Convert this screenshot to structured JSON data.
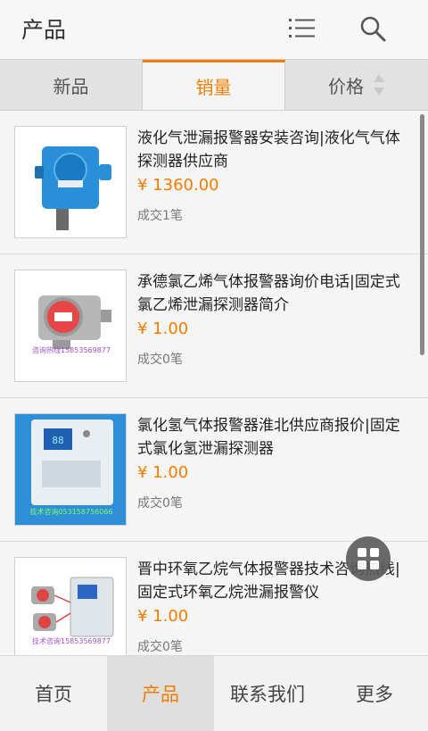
{
  "header": {
    "title": "产品",
    "menu_icon": "list-menu-icon",
    "search_icon": "search-icon"
  },
  "tabs": [
    {
      "label": "新品",
      "active": false
    },
    {
      "label": "销量",
      "active": true
    },
    {
      "label": "价格",
      "active": false,
      "icon": "sort-arrows-icon"
    }
  ],
  "products": [
    {
      "name": "液化气泄漏报警器安装咨询|液化气气体探测器供应商",
      "price": "¥ 1360.00",
      "sold": "成交1笔",
      "image_text": ""
    },
    {
      "name": "承德氯乙烯气体报警器询价电话|固定式氯乙烯泄漏探测器简介",
      "price": "¥ 1.00",
      "sold": "成交0笔",
      "image_text": "咨询热线15853569877"
    },
    {
      "name": "氯化氢气体报警器淮北供应商报价|固定式氯化氢泄漏探测器",
      "price": "¥ 1.00",
      "sold": "成交0笔",
      "image_text": "技术咨询053158756066"
    },
    {
      "name": "晋中环氧乙烷气体报警器技术咨询热线|固定式环氧乙烷泄漏报警仪",
      "price": "¥ 1.00",
      "sold": "成交0笔",
      "image_text": "技术咨询15853569877"
    }
  ],
  "fab_icon": "grid-menu-icon",
  "bottom_nav": [
    {
      "label": "首页",
      "active": false
    },
    {
      "label": "产品",
      "active": true
    },
    {
      "label": "联系我们",
      "active": false
    },
    {
      "label": "更多",
      "active": false
    }
  ],
  "colors": {
    "accent": "#f07d00",
    "background": "#f3f3f3"
  }
}
